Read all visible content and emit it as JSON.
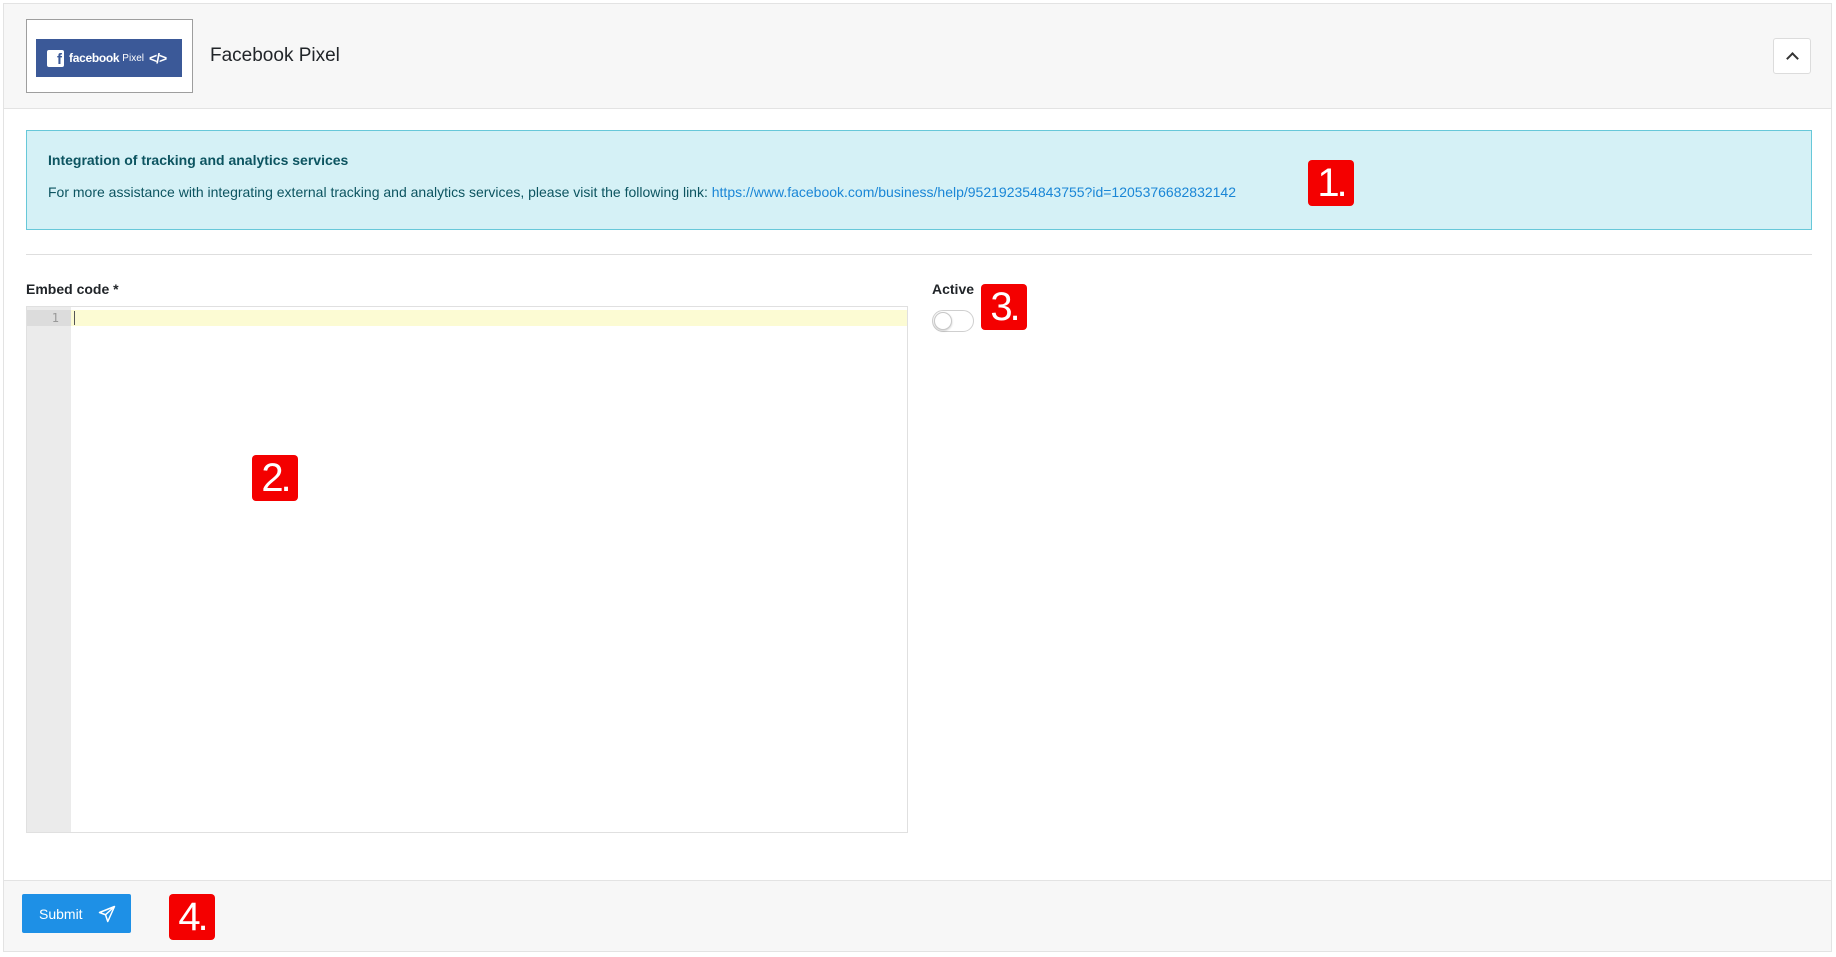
{
  "header": {
    "title": "Facebook Pixel",
    "logo": {
      "brand": "facebook",
      "sub": "Pixel",
      "code": "</>",
      "f": "f"
    },
    "collapse_icon": "chevron-up-icon"
  },
  "alert": {
    "title": "Integration of tracking and analytics services",
    "text": "For more assistance with integrating external tracking and analytics services, please visit the following link:",
    "link": "https://www.facebook.com/business/help/952192354843755?id=1205376682832142"
  },
  "form": {
    "embed_label": "Embed code *",
    "line_number": "1",
    "active_label": "Active",
    "active_value": false
  },
  "footer": {
    "submit_label": "Submit",
    "submit_icon": "paper-plane-icon"
  },
  "markers": [
    "1.",
    "2.",
    "3.",
    "4."
  ],
  "colors": {
    "primary": "#1e90e6",
    "alert_bg": "#d5f1f6",
    "alert_border": "#67c8d9",
    "marker": "#f40000",
    "facebook_blue": "#3b5998"
  }
}
